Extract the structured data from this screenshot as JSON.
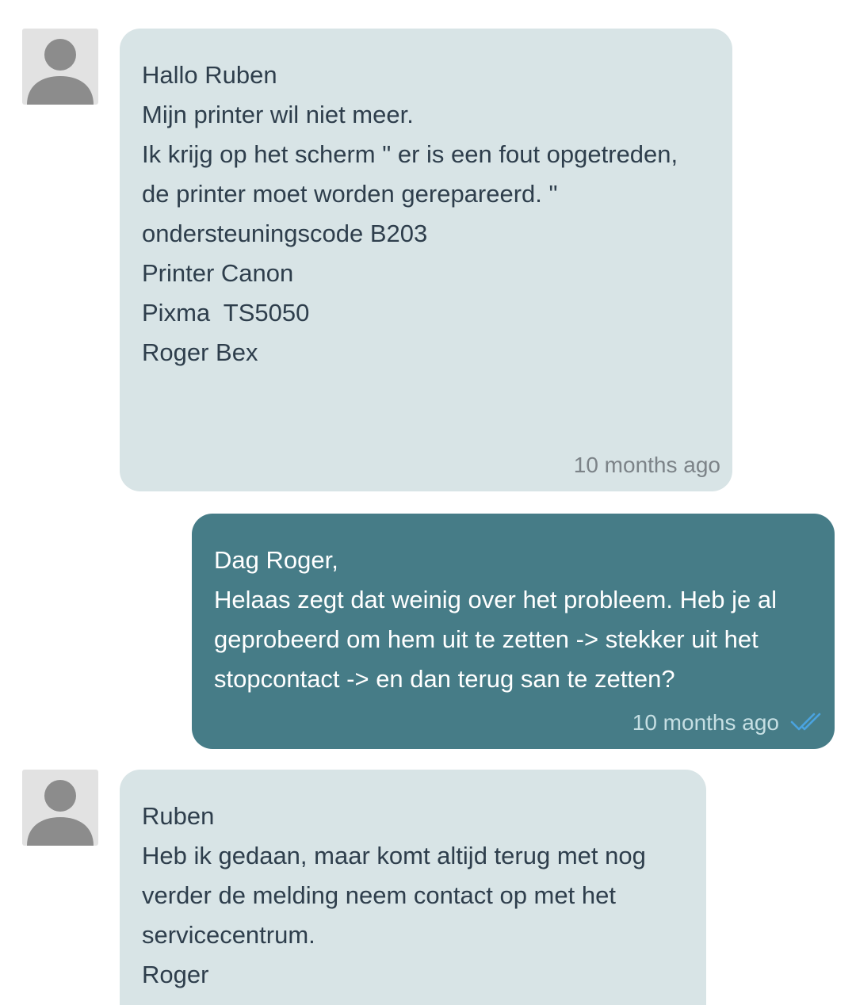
{
  "messages": [
    {
      "direction": "incoming",
      "lines": [
        "Hallo Ruben",
        "Mijn printer wil niet meer.",
        "Ik krijg op het scherm \" er is een fout opgetreden,",
        "de printer moet worden gerepareerd. \"",
        "ondersteuningscode B203",
        "Printer Canon",
        "Pixma  TS5050",
        "Roger Bex"
      ],
      "timestamp": "10 months ago",
      "avatar_icon": "default-user-avatar-icon"
    },
    {
      "direction": "outgoing",
      "lines": [
        "Dag Roger,",
        "Helaas zegt dat weinig over het probleem. Heb je al",
        "geprobeerd om hem uit te zetten -> stekker uit het",
        "stopcontact -> en dan terug san te zetten?"
      ],
      "timestamp": "10 months ago",
      "read_receipt_icon": "double-check-icon"
    },
    {
      "direction": "incoming",
      "lines": [
        "Ruben",
        "Heb ik gedaan, maar komt altijd terug met nog",
        "verder de melding neem contact op met het",
        "servicecentrum.",
        "Roger"
      ],
      "avatar_icon": "default-user-avatar-icon"
    }
  ],
  "colors": {
    "incoming_bubble": "#d8e4e6",
    "outgoing_bubble": "#467c87",
    "incoming_text": "#2e3e4c",
    "outgoing_text": "#ffffff",
    "read_receipt": "#4aa3df"
  }
}
